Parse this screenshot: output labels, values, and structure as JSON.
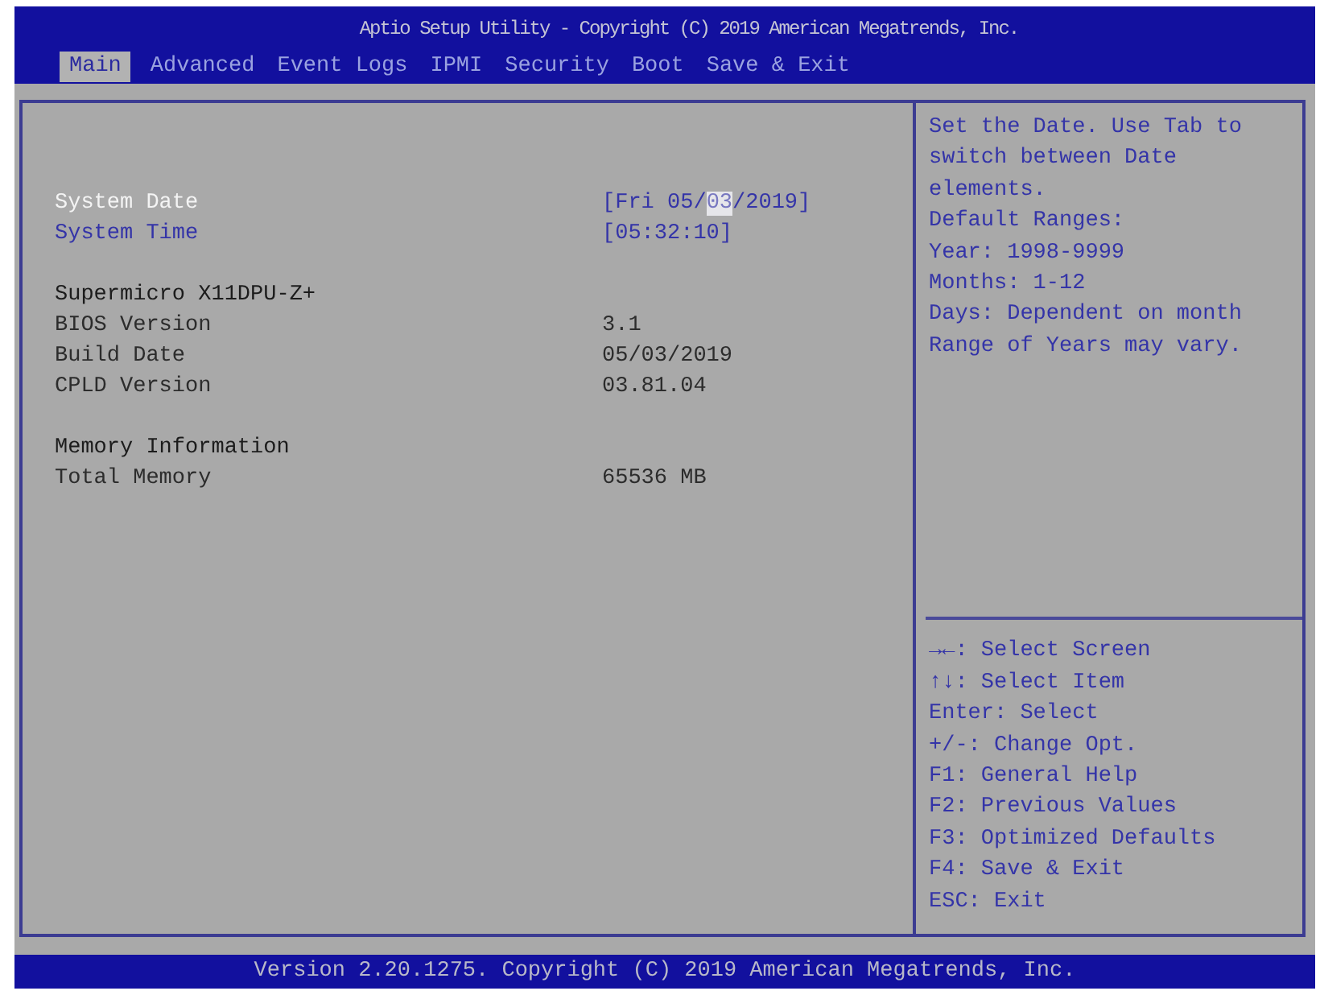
{
  "header": {
    "title": "Aptio Setup Utility - Copyright (C) 2019 American Megatrends, Inc."
  },
  "tabs": [
    {
      "label": "Main",
      "selected": true
    },
    {
      "label": "Advanced",
      "selected": false
    },
    {
      "label": "Event Logs",
      "selected": false
    },
    {
      "label": "IPMI",
      "selected": false
    },
    {
      "label": "Security",
      "selected": false
    },
    {
      "label": "Boot",
      "selected": false
    },
    {
      "label": "Save & Exit",
      "selected": false
    }
  ],
  "sections": [
    {
      "rows": [
        {
          "kind": "setting",
          "label": "System Date",
          "selected": true,
          "value_parts": [
            {
              "text": "[Fri 05/",
              "selected": false
            },
            {
              "text": "03",
              "selected": true
            },
            {
              "text": "/2019]",
              "selected": false
            }
          ]
        },
        {
          "kind": "setting",
          "label": "System Time",
          "selected": false,
          "value_parts": [
            {
              "text": "[05:32:10]",
              "selected": false
            }
          ]
        }
      ]
    },
    {
      "rows": [
        {
          "kind": "heading",
          "label": "Supermicro X11DPU-Z+"
        },
        {
          "kind": "info",
          "label": "BIOS Version",
          "value": "3.1"
        },
        {
          "kind": "info",
          "label": "Build Date",
          "value": "05/03/2019"
        },
        {
          "kind": "info",
          "label": "CPLD Version",
          "value": "03.81.04"
        }
      ]
    },
    {
      "rows": [
        {
          "kind": "heading",
          "label": "Memory Information"
        },
        {
          "kind": "info",
          "label": "Total Memory",
          "value": "65536 MB"
        }
      ]
    }
  ],
  "help": [
    "Set the Date. Use Tab to",
    "switch between Date",
    "elements.",
    "Default Ranges:",
    "Year: 1998-9999",
    "Months: 1-12",
    "Days: Dependent on month",
    "Range of Years may vary."
  ],
  "keys": [
    "→←: Select Screen",
    "↑↓: Select Item",
    "Enter: Select",
    "+/-: Change Opt.",
    "F1: General Help",
    "F2: Previous Values",
    "F3: Optimized Defaults",
    "F4: Save & Exit",
    "ESC: Exit"
  ],
  "footer": {
    "text": "Version 2.20.1275. Copyright (C) 2019 American Megatrends, Inc."
  }
}
